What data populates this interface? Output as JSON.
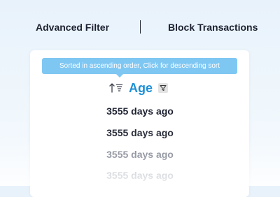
{
  "header": {
    "tabs": [
      {
        "label": "Advanced Filter"
      },
      {
        "label": "Block Transactions"
      }
    ]
  },
  "tooltip": {
    "text": "Sorted in ascending order, Click for descending sort"
  },
  "column": {
    "title": "Age",
    "sort_icon": "sort-ascending-icon",
    "filter_icon": "filter-icon"
  },
  "rows": [
    {
      "age": "3555 days ago"
    },
    {
      "age": "3555 days ago"
    },
    {
      "age": "3555 days ago"
    },
    {
      "age": "3555 days ago"
    }
  ],
  "colors": {
    "accent": "#1d8fd6",
    "tooltip_bg": "#7fc7f3",
    "text_dark": "#1d2130"
  }
}
